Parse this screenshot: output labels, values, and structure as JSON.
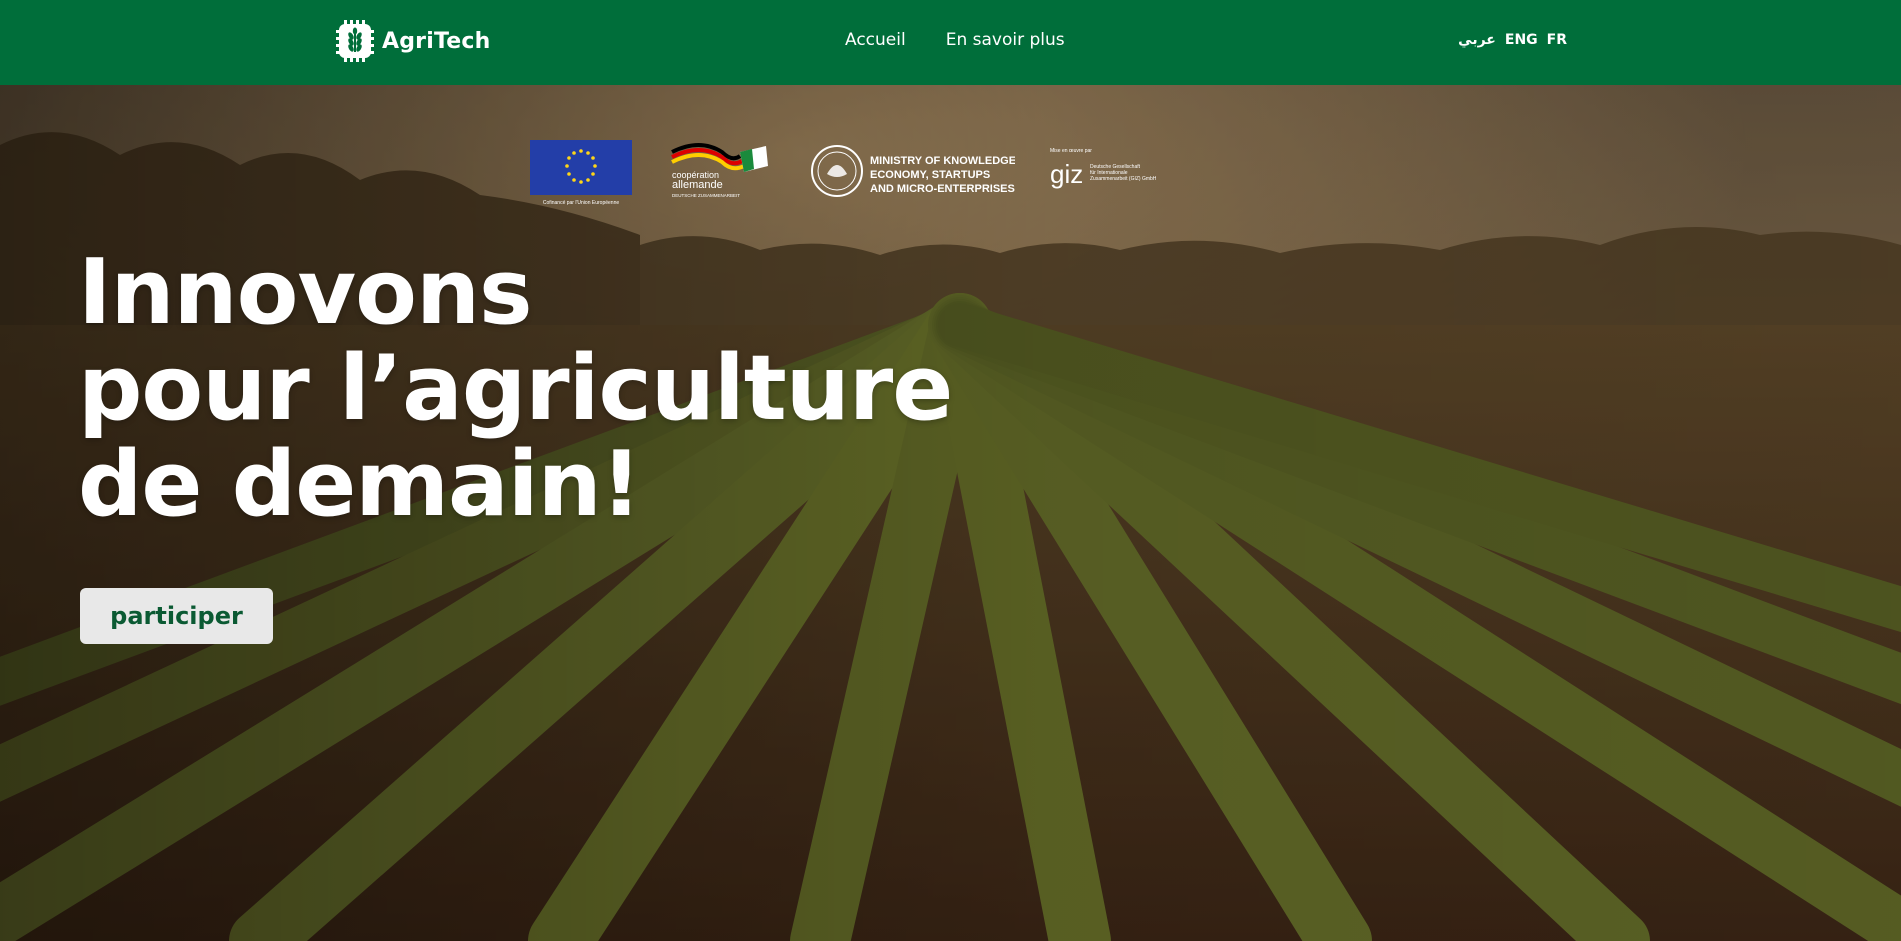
{
  "header": {
    "brand": "AgriTech",
    "logo_icon": "wheat-chip-icon",
    "nav": [
      {
        "label": "Accueil"
      },
      {
        "label": "En savoir plus"
      }
    ],
    "languages": [
      {
        "label": "عربي"
      },
      {
        "label": "ENG"
      },
      {
        "label": "FR"
      }
    ]
  },
  "partners": {
    "eu": {
      "caption": "Cofinancé par l'Union Européenne"
    },
    "german": {
      "line1": "coopération",
      "line2": "allemande",
      "line3": "DEUTSCHE ZUSAMMENARBEIT"
    },
    "ministry": {
      "line1": "MINISTRY OF KNOWLEDGE",
      "line2": "ECONOMY, STARTUPS",
      "line3": "AND MICRO-ENTERPRISES"
    },
    "giz": {
      "pre": "Mise en œuvre par",
      "mark": "giz",
      "l1": "Deutsche Gesellschaft",
      "l2": "für Internationale",
      "l3": "Zusammenarbeit (GIZ) GmbH"
    }
  },
  "hero": {
    "headline_lines": [
      "Innovons",
      "pour l’agriculture",
      "de demain!"
    ],
    "cta_label": "participer",
    "background": "agricultural field rows at sunset"
  },
  "colors": {
    "header_bg": "#006e3a",
    "cta_bg": "#e8e8e8",
    "cta_text": "#0b5a33",
    "eu_blue": "#233ea8",
    "eu_star": "#ffd617"
  }
}
